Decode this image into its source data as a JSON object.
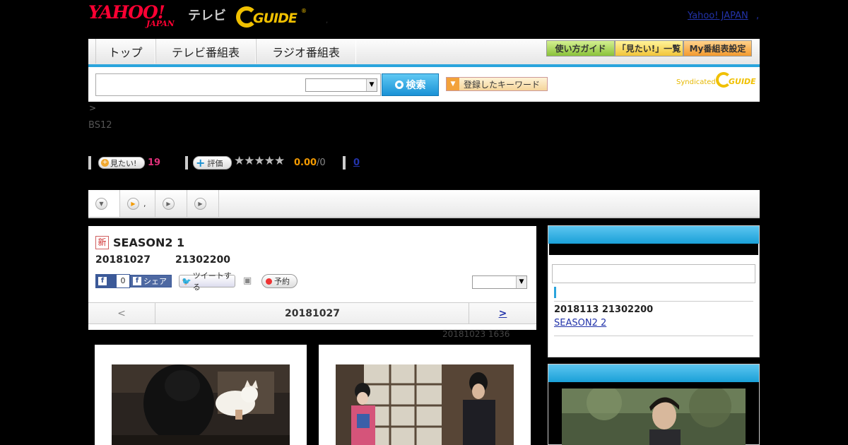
{
  "header": {
    "yahoo_logo_top": "YAHOO!",
    "yahoo_logo_bottom": "JAPAN",
    "tv_label": "テレビ",
    "gguide_logo": "GUIDE",
    "gguide_reg": "®",
    "separator": ",",
    "yahoo_japan_link": "Yahoo! JAPAN",
    "link_comma": ","
  },
  "nav": {
    "tabs": [
      {
        "label": "トップ"
      },
      {
        "label": "テレビ番組表"
      },
      {
        "label": "ラジオ番組表"
      }
    ],
    "guide_label": "使い方ガイド",
    "mitai_list_label": "「見たい!」一覧",
    "my_schedule_label": "My番組表設定"
  },
  "search": {
    "input_value": "",
    "select_value": "",
    "button_label": "検索",
    "keyword_button_label": "登録したキーワード",
    "syndicated_label": "Syndicated",
    "syndicated_logo": "GUIDE"
  },
  "breadcrumb": ">",
  "channel": "BS12",
  "rating": {
    "mitai_label": "見たい!",
    "mitai_count": "19",
    "hyoka_label": "評価",
    "stars": "★★★★★",
    "score": "0.00",
    "score_den": "/0",
    "comment_count": "0"
  },
  "subtabs": [
    {
      "label": ""
    },
    {
      "label": ","
    },
    {
      "label": ""
    },
    {
      "label": ""
    }
  ],
  "program": {
    "new_badge": "新",
    "title": "SEASON2 1",
    "date": "20181027",
    "time": "21302200",
    "fb_like_count": "0",
    "fb_share_label": "シェア",
    "tweet_label": "ツイートする",
    "yoyaku_label": "予約",
    "select_value": "",
    "pager_prev": "<",
    "pager_date": "20181027",
    "pager_next": ">"
  },
  "updated": "20181023  1636",
  "sidebar": {
    "next_date": "2018113  21302200",
    "next_link": "SEASON2 2"
  },
  "colors": {
    "accent_blue": "#2aa4dc",
    "highlight_pink": "#e0307a",
    "score_orange": "#f39a00",
    "link_blue": "#2233aa"
  }
}
